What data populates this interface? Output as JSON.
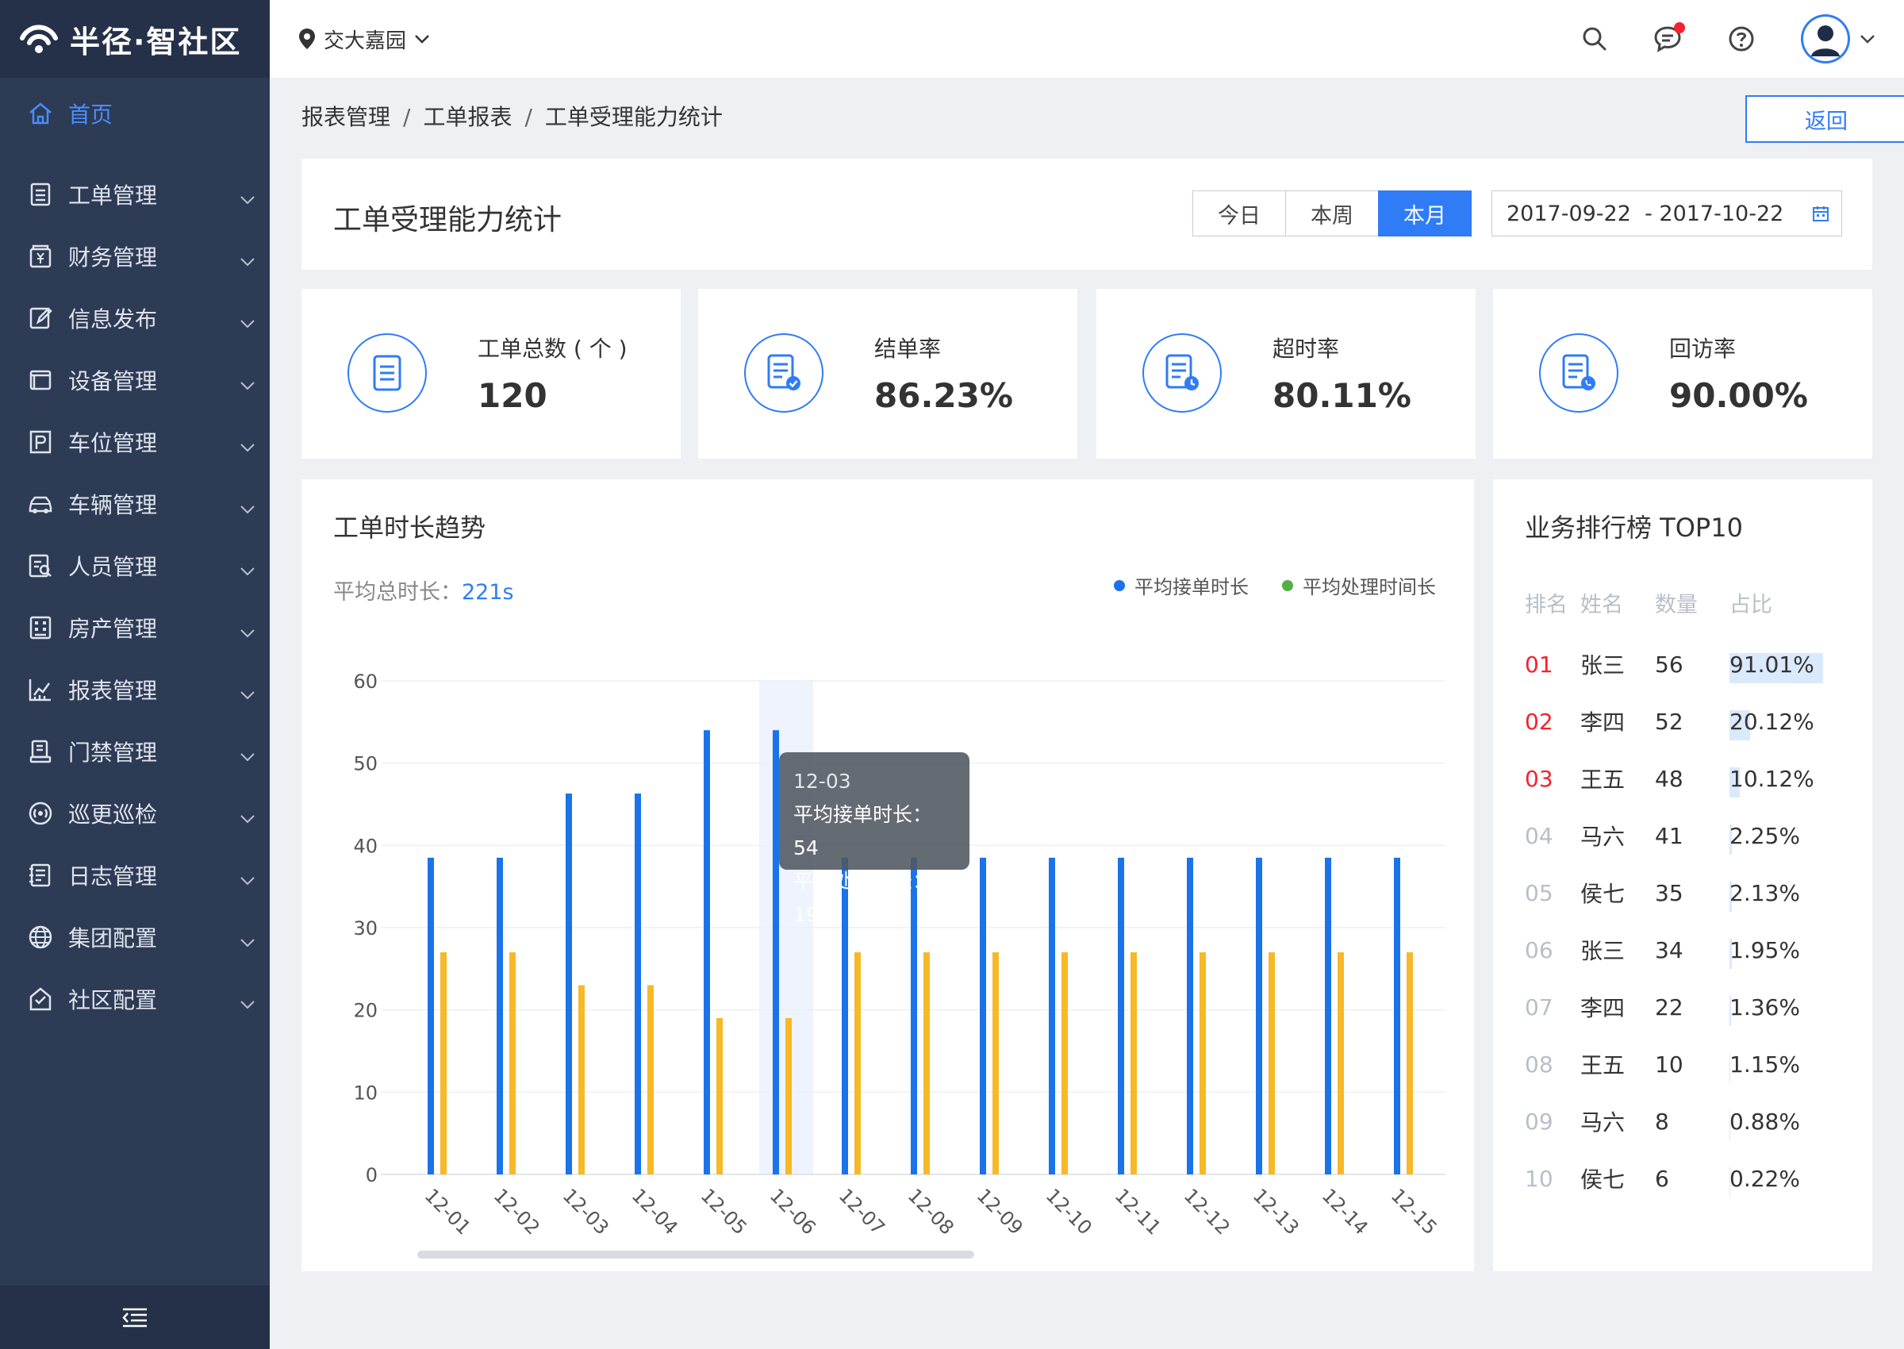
{
  "app": {
    "logo_text": "半径·智社区"
  },
  "sidebar": {
    "items": [
      {
        "label": "首页",
        "icon": "home-icon",
        "active": true
      },
      {
        "label": "工单管理",
        "icon": "list-icon"
      },
      {
        "label": "财务管理",
        "icon": "finance-icon"
      },
      {
        "label": "信息发布",
        "icon": "edit-icon"
      },
      {
        "label": "设备管理",
        "icon": "device-icon"
      },
      {
        "label": "车位管理",
        "icon": "parking-icon"
      },
      {
        "label": "车辆管理",
        "icon": "car-icon"
      },
      {
        "label": "人员管理",
        "icon": "person-icon"
      },
      {
        "label": "房产管理",
        "icon": "building-icon"
      },
      {
        "label": "报表管理",
        "icon": "report-icon"
      },
      {
        "label": "门禁管理",
        "icon": "access-icon"
      },
      {
        "label": "巡更巡检",
        "icon": "patrol-icon"
      },
      {
        "label": "日志管理",
        "icon": "log-icon"
      },
      {
        "label": "集团配置",
        "icon": "globe-icon"
      },
      {
        "label": "社区配置",
        "icon": "community-icon"
      }
    ]
  },
  "topbar": {
    "location": "交大嘉园"
  },
  "breadcrumb": [
    "报表管理",
    "工单报表",
    "工单受理能力统计"
  ],
  "back_label": "返回",
  "page_title": "工单受理能力统计",
  "range_tabs": [
    "今日",
    "本周",
    "本月"
  ],
  "range_active": "本月",
  "date_range": "2017-09-22  - 2017-10-22",
  "stats": [
    {
      "label": "工单总数 ( 个 )",
      "value": "120"
    },
    {
      "label": "结单率",
      "value": "86.23%"
    },
    {
      "label": "超时率",
      "value": "80.11%"
    },
    {
      "label": "回访率",
      "value": "90.00%"
    }
  ],
  "trend": {
    "title": "工单时长趋势",
    "avg_label": "平均总时长：",
    "avg_value": "221s",
    "legend": [
      "平均接单时长",
      "平均处理时间长"
    ],
    "tooltip": {
      "date": "12-03",
      "line1": "平均接单时长：54",
      "line2": "平均处理时长：19"
    }
  },
  "chart_data": {
    "type": "bar",
    "categories": [
      "12-01",
      "12-02",
      "12-03",
      "12-04",
      "12-05",
      "12-06",
      "12-07",
      "12-08",
      "12-09",
      "12-10",
      "12-11",
      "12-12",
      "12-13",
      "12-14",
      "12-15"
    ],
    "series": [
      {
        "name": "平均接单时长",
        "color": "#1a73e8",
        "values": [
          38.5,
          38.5,
          46.3,
          46.3,
          54,
          54,
          38.5,
          38.5,
          38.5,
          38.5,
          38.5,
          38.5,
          38.5,
          38.5,
          38.5
        ]
      },
      {
        "name": "平均处理时间长",
        "color": "#f7b928",
        "values": [
          27,
          27,
          23,
          23,
          19,
          19,
          27,
          27,
          27,
          27,
          27,
          27,
          27,
          27,
          27
        ]
      }
    ],
    "ylim": [
      0,
      60
    ],
    "yticks": [
      0,
      10,
      20,
      30,
      40,
      50,
      60
    ],
    "highlight_index": 5,
    "grid": true,
    "legend": "top-right"
  },
  "ranking": {
    "title": "业务排行榜 TOP10",
    "headers": [
      "排名",
      "姓名",
      "数量",
      "占比"
    ],
    "rows": [
      {
        "rank": "01",
        "name": "张三",
        "count": "56",
        "pct": "91.01%",
        "share": 0.9101
      },
      {
        "rank": "02",
        "name": "李四",
        "count": "52",
        "pct": "20.12%",
        "share": 0.2012
      },
      {
        "rank": "03",
        "name": "王五",
        "count": "48",
        "pct": "10.12%",
        "share": 0.1012
      },
      {
        "rank": "04",
        "name": "马六",
        "count": "41",
        "pct": "2.25%",
        "share": 0.0225
      },
      {
        "rank": "05",
        "name": "侯七",
        "count": "35",
        "pct": "2.13%",
        "share": 0.0213
      },
      {
        "rank": "06",
        "name": "张三",
        "count": "34",
        "pct": "1.95%",
        "share": 0.0195
      },
      {
        "rank": "07",
        "name": "李四",
        "count": "22",
        "pct": "1.36%",
        "share": 0.0136
      },
      {
        "rank": "08",
        "name": "王五",
        "count": "10",
        "pct": "1.15%",
        "share": 0.0115
      },
      {
        "rank": "09",
        "name": "马六",
        "count": "8",
        "pct": "0.88%",
        "share": 0.0088
      },
      {
        "rank": "10",
        "name": "侯七",
        "count": "6",
        "pct": "0.22%",
        "share": 0.0022
      }
    ]
  },
  "colors": {
    "accent": "#2f7cf6",
    "sidebar_bg": "#2d3b55",
    "top_rank": "#f5222d",
    "rank_muted": "#b9bec8"
  }
}
